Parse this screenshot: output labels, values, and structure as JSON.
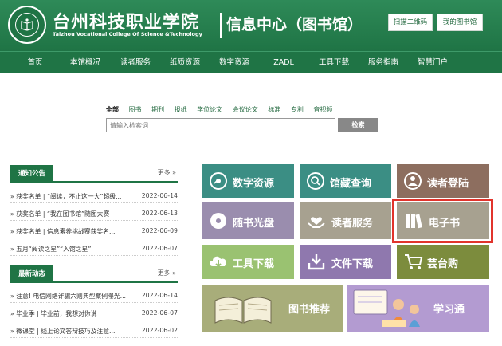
{
  "header": {
    "school_name_cn": "台州科技职业学院",
    "school_name_en": "Taizhou Vocational College Of Science &Technology",
    "site_title": "信息中心（图书馆）",
    "scan_button": "扫描二维码",
    "my_library_button": "我的图书馆"
  },
  "nav": [
    "首页",
    "本馆概况",
    "读者服务",
    "纸质资源",
    "数字资源",
    "ZADL",
    "工具下载",
    "服务指南",
    "智慧门户"
  ],
  "search": {
    "tabs": [
      "全部",
      "图书",
      "期刊",
      "报纸",
      "学位论文",
      "会议论文",
      "标准",
      "专利",
      "音视频"
    ],
    "placeholder": "请输入检索词",
    "button": "检索"
  },
  "notices": {
    "title": "通知公告",
    "more": "更多 »",
    "items": [
      {
        "text": "» 获奖名单 | “阅读，不止这一大”超级...",
        "date": "2022-06-14"
      },
      {
        "text": "» 获奖名单 | “我在图书馆”随图大赛",
        "date": "2022-06-13"
      },
      {
        "text": "» 获奖名单 | 信息素养挑战赛获奖名...",
        "date": "2022-06-09"
      },
      {
        "text": "» 五月“阅读之星”“入馆之星”",
        "date": "2022-06-07"
      }
    ]
  },
  "news": {
    "title": "最新动态",
    "more": "更多 »",
    "items": [
      {
        "text": "» 注意! 电信网络诈骗六则典型案例曝光...",
        "date": "2022-06-14"
      },
      {
        "text": "» 毕业季 | 毕业前，我想对你说",
        "date": "2022-06-07"
      },
      {
        "text": "» 微课堂 | 线上论文答辩技巧及注意...",
        "date": "2022-06-02"
      }
    ]
  },
  "tiles": {
    "digital": "数字资源",
    "collection": "馆藏查询",
    "login": "读者登陆",
    "cd": "随书光盘",
    "service": "读者服务",
    "ebook": "电子书",
    "tools": "工具下载",
    "files": "文件下载",
    "yuntai": "芸台购",
    "recommend": "图书推荐",
    "study": "学习通"
  },
  "colors": {
    "brand_green": "#1f7445",
    "teal": "#3b8e84",
    "brown": "#8d6e5f",
    "lavender": "#9a8dae",
    "tan": "#a7a190",
    "lime": "#9ac271",
    "purple": "#8f78ae",
    "olive": "#7c8c3d",
    "highlight_red": "#e1342c"
  }
}
